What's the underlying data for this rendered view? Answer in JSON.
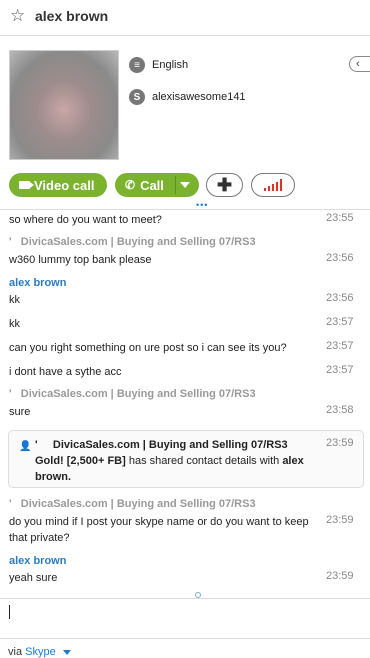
{
  "header": {
    "contact_name": "alex brown"
  },
  "profile": {
    "language": "English",
    "skype_name": "alexisawesome141"
  },
  "actions": {
    "video_call_label": "Video call",
    "call_label": "Call"
  },
  "messages": [
    {
      "text": "so where do you want to meet?",
      "time": "23:55"
    },
    {
      "sender": "DivicaSales.com  |  Buying and Selling 07/RS3",
      "text": "w360 lummy top bank please",
      "time": "23:56"
    },
    {
      "sender": "alex brown",
      "text": "kk",
      "time": "23:56"
    },
    {
      "text": "kk",
      "time": "23:57"
    },
    {
      "text": "can you right something on ure post so i can see its you?",
      "time": "23:57"
    },
    {
      "text": "i dont have a sythe acc",
      "time": "23:57"
    },
    {
      "sender": "DivicaSales.com  |  Buying and Selling 07/RS3",
      "text": "sure",
      "time": "23:58"
    },
    {
      "sender": "DivicaSales.com  |  Buying and Selling 07/RS3",
      "text": "do you mind if I post your skype name or do you want to keep that private?",
      "time": "23:59"
    },
    {
      "sender": "alex brown",
      "text": "yeah sure",
      "time": "23:59"
    }
  ],
  "shared_contact": {
    "sender_name": "DivicaSales.com  |  Buying and Selling 07/RS3 Gold! [2,500+ FB]",
    "text_middle": " has shared contact details with ",
    "contact": "alex brown.",
    "time": "23:59"
  },
  "footer": {
    "via_label": "via",
    "service": "Skype"
  }
}
